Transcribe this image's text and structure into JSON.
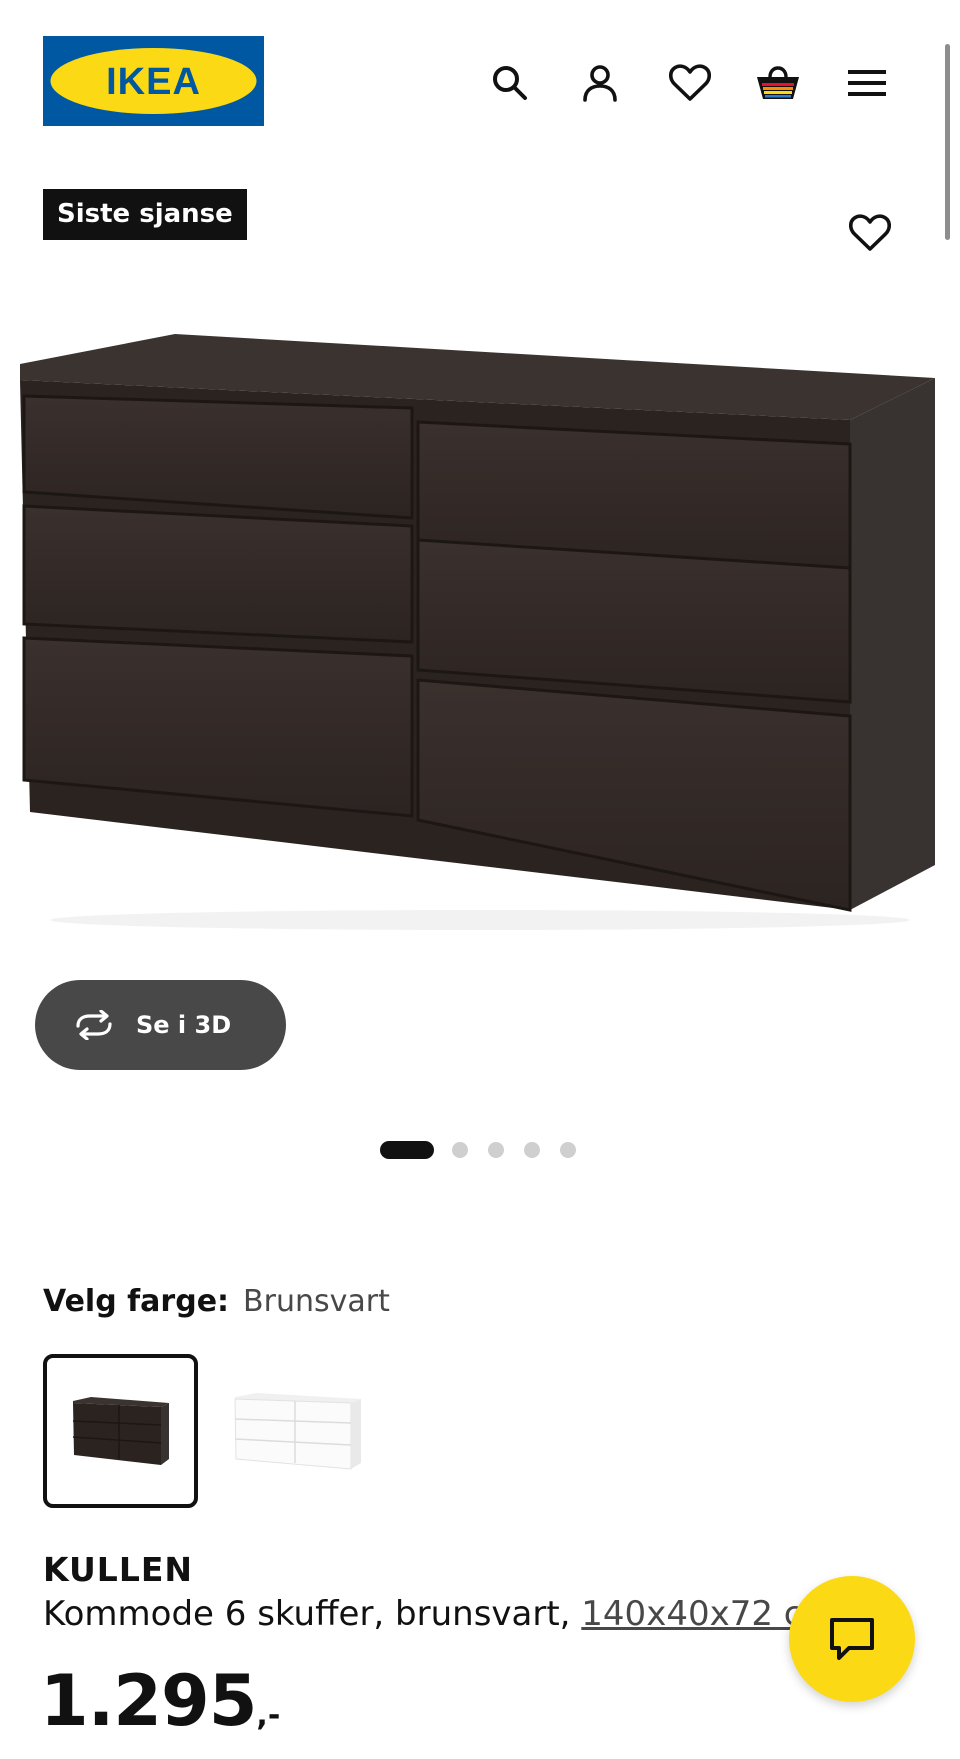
{
  "header": {
    "logo_text": "IKEA",
    "icons": [
      "search-icon",
      "account-icon",
      "wishlist-icon",
      "cart-icon",
      "menu-icon"
    ]
  },
  "product": {
    "badge": "Siste sjanse",
    "view_3d_label": "Se i 3D",
    "gallery": {
      "total_images": 5,
      "active_index": 0
    },
    "color": {
      "label": "Velg farge:",
      "selected": "Brunsvart",
      "options": [
        "Brunsvart",
        "Hvit"
      ]
    },
    "name": "KULLEN",
    "description_prefix": "Kommode 6 skuffer, brunsvart, ",
    "dimensions": "140x40x72 cm",
    "price_integer": "1.295",
    "price_suffix": ",-"
  },
  "colors": {
    "brand_blue": "#0058a3",
    "brand_yellow": "#fbd914",
    "badge_bg": "#111111",
    "button_dark": "#484848"
  }
}
